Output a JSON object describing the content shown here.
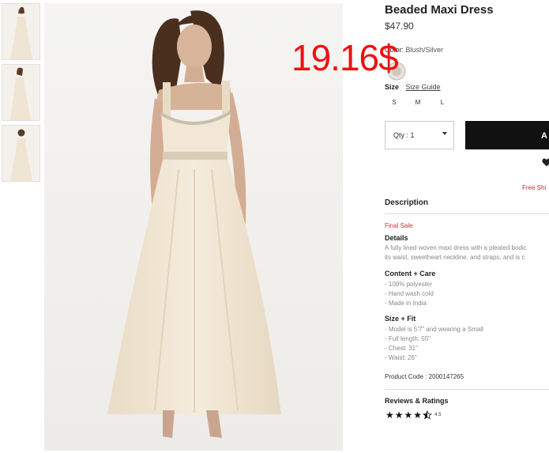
{
  "product": {
    "title": "Beaded Maxi Dress",
    "price": "$47.90",
    "overlay_price": "19.16$",
    "color_label": "Color:",
    "color_value": "Blush/Silver",
    "size_label": "Size",
    "size_guide": "Size Guide",
    "sizes": [
      "S",
      "M",
      "L"
    ]
  },
  "purchase": {
    "qty_text": "Qty : 1",
    "add_label": "A",
    "free_shipping": "Free Shi"
  },
  "description": {
    "heading": "Description",
    "final_sale": "Final Sale",
    "details_heading": "Details",
    "details_lines": [
      "A fully lined woven maxi dress with a pleated bodic",
      "its waist, sweetheart neckline, and straps, and is c"
    ],
    "content_heading": "Content + Care",
    "content_lines": [
      "- 100% polyester",
      "- Hand wash cold",
      "- Made in India"
    ],
    "fit_heading": "Size + Fit",
    "fit_lines": [
      "- Model is 5'7\" and wearing a Small",
      "- Full length: 55\"",
      "- Chest: 31\"",
      "- Waist: 26\""
    ],
    "product_code": "Product Code : 2000147265"
  },
  "reviews": {
    "heading": "Reviews & Ratings",
    "rating": "4.5",
    "stars_filled": 4.5
  },
  "colors": {
    "overlay_red": "#ee1111",
    "sale_red": "#cc3333",
    "button_black": "#111111",
    "dress_cream": "#f3e8d6"
  }
}
